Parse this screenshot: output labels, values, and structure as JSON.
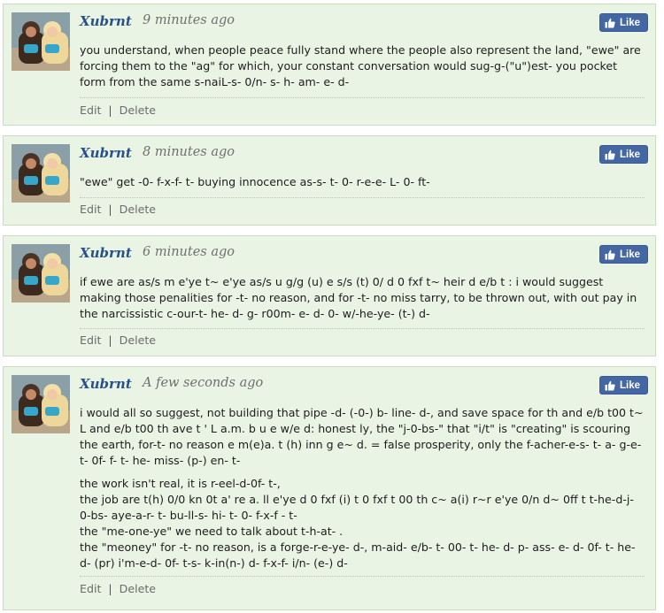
{
  "like_label": "Like",
  "edit_label": "Edit",
  "delete_label": "Delete",
  "action_separator": "|",
  "comments": [
    {
      "author": "Xubrnt",
      "time": "9 minutes ago",
      "paragraphs": [
        "you understand, when people peace fully stand where the people also represent the land, \"ewe\" are forcing them to the \"ag\" for which, your constant conversation would sug-g-(\"u\")est- you pocket form from the same s-naiL-s- 0/n- s- h- am- e- d-"
      ]
    },
    {
      "author": "Xubrnt",
      "time": "8 minutes ago",
      "paragraphs": [
        "\"ewe\" get -0- f-x-f- t- buying innocence as-s- t- 0- r-e-e- L- 0- ft-"
      ]
    },
    {
      "author": "Xubrnt",
      "time": "6 minutes ago",
      "paragraphs": [
        "if ewe are as/s m e'ye t~ e'ye as/s u g/g (u) e s/s (t) 0/ d 0 fxf t~ heir d e/b t : i would suggest making those penalities for -t- no reason, and for -t- no miss tarry, to be thrown out, with out pay in the narcissistic c-our-t- he- d- g- r00m- e- d- 0- w/-he-ye- (t-) d-"
      ]
    },
    {
      "author": "Xubrnt",
      "time": "A few seconds ago",
      "paragraphs": [
        "i would all so suggest, not building that pipe -d- (-0-) b- line- d-, and save space for th and e/b t00 t~ L and e/b t00 th ave t ' L a.m. b u e w/e d: honest ly, the \"j-0-bs-\" that \"i/t\" is \"creating\" is scouring the earth, for-t- no reason e m(e)a. t (h) inn g e~ d. = false prosperity, only the f-acher-e-s- t- a- g-e- t- 0f- f- t- he- miss- (p-) en- t-",
        "the work isn't real, it is r-eel-d-0f- t-,",
        "the job are t(h) 0/0 kn 0t a' re a. ll e'ye d 0 fxf (i) t 0 fxf t 00 th c~ a(i) r~r e'ye 0/n d~ 0ff t t-he-d-j-0-bs- aye-a-r- t- bu-ll-s- hi- t- 0- f-x-f - t-",
        "the \"me-one-ye\" we need to talk about t-h-at- .",
        "the \"meoney\" for -t- no reason, is a forge-r-e-ye- d-, m-aid- e/b- t- 00- t- he- d- p- ass- e- d- 0f- t- he- d- (pr) i'm-e-d- 0f- t-s- k-in(n-) d- f-x-f- i/n- (e-) d-"
      ]
    }
  ]
}
